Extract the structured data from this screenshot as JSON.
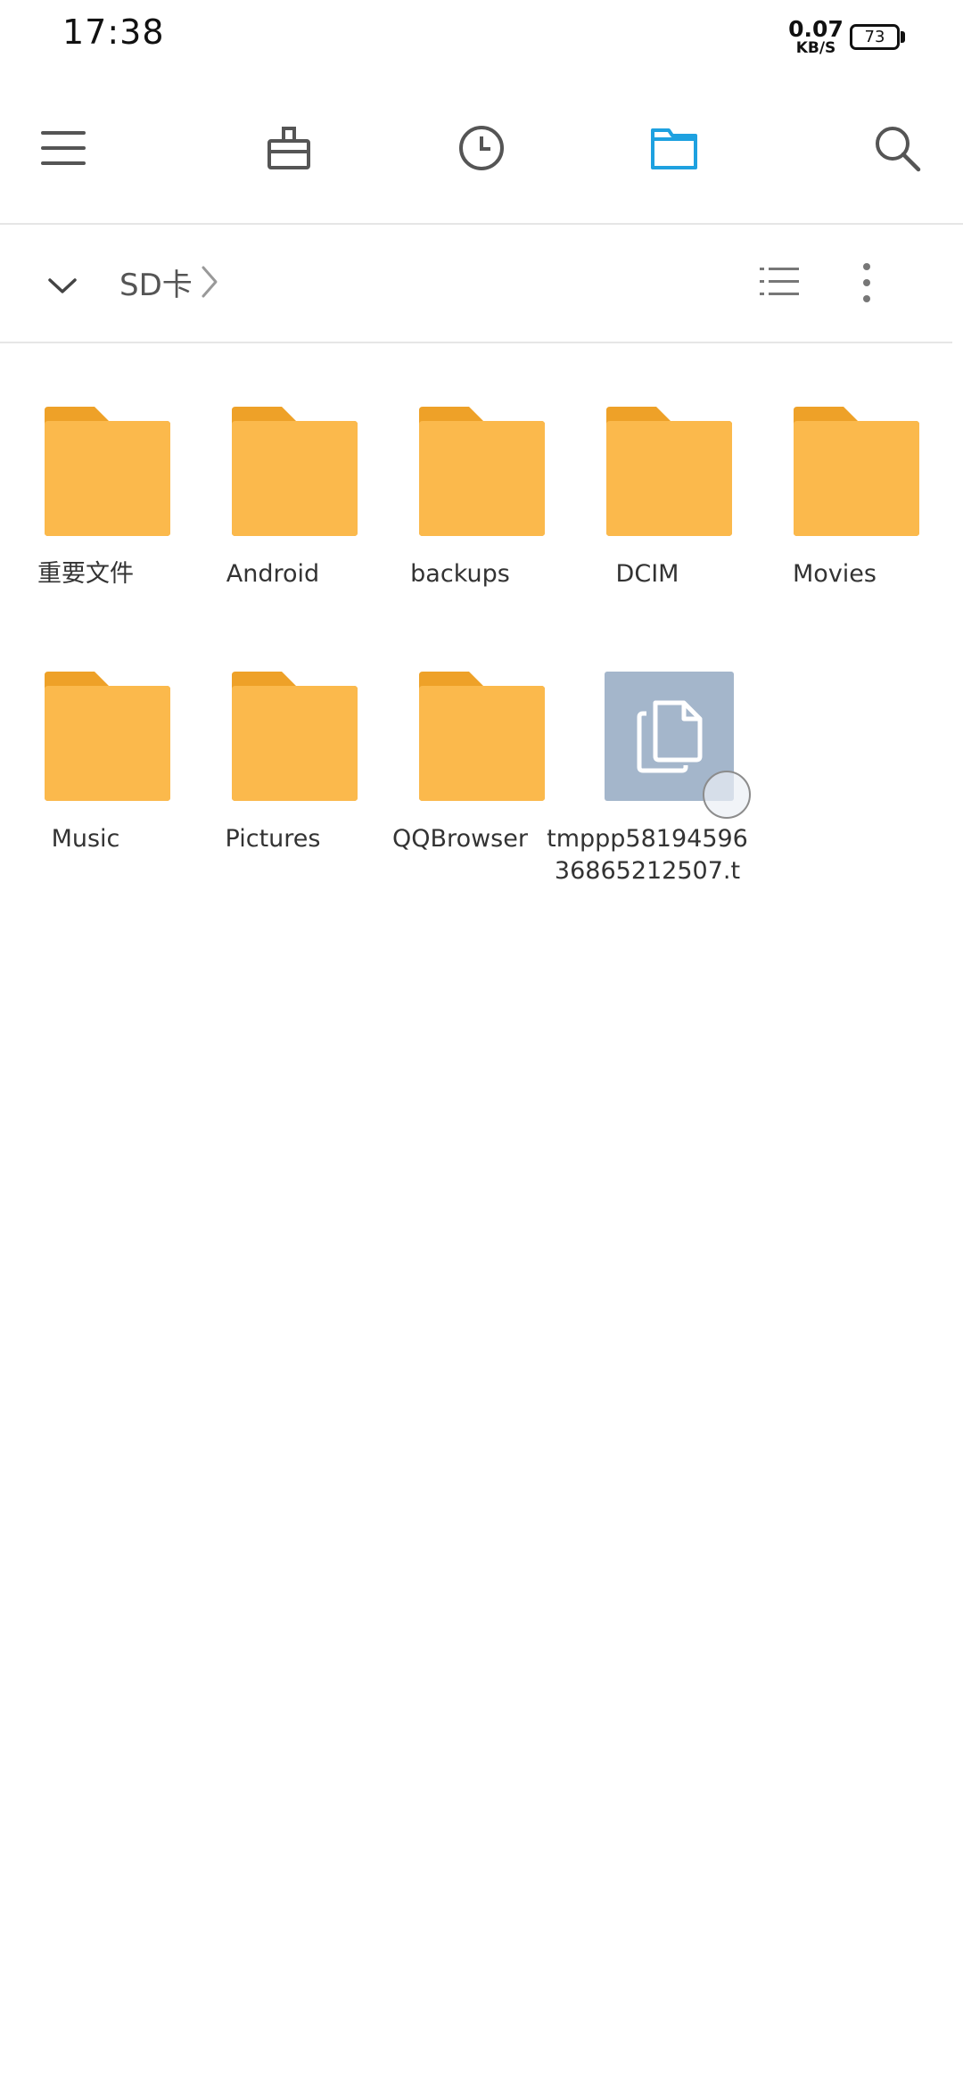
{
  "status": {
    "time": "17:38",
    "net_speed_value": "0.07",
    "net_speed_unit": "KB/S",
    "battery": "73"
  },
  "toolbar": {
    "icons": [
      "menu-icon",
      "toolbox-icon",
      "recent-clock-icon",
      "folder-icon",
      "search-icon"
    ],
    "active": "folder-icon",
    "accent": "#1ea1e0"
  },
  "path": {
    "current": "SD卡"
  },
  "items": [
    {
      "name": "重要文件",
      "type": "folder"
    },
    {
      "name": "Android",
      "type": "folder"
    },
    {
      "name": "backups",
      "type": "folder"
    },
    {
      "name": "DCIM",
      "type": "folder"
    },
    {
      "name": "Movies",
      "type": "folder"
    },
    {
      "name": "Music",
      "type": "folder"
    },
    {
      "name": "Pictures",
      "type": "folder"
    },
    {
      "name": "QQBrowser",
      "type": "folder"
    },
    {
      "name": "tmppp5819459636865212507.t",
      "type": "file"
    }
  ],
  "colors": {
    "folder_body": "#fbb94c",
    "folder_tab": "#eea128",
    "file_thumb": "#a4b6cb"
  }
}
